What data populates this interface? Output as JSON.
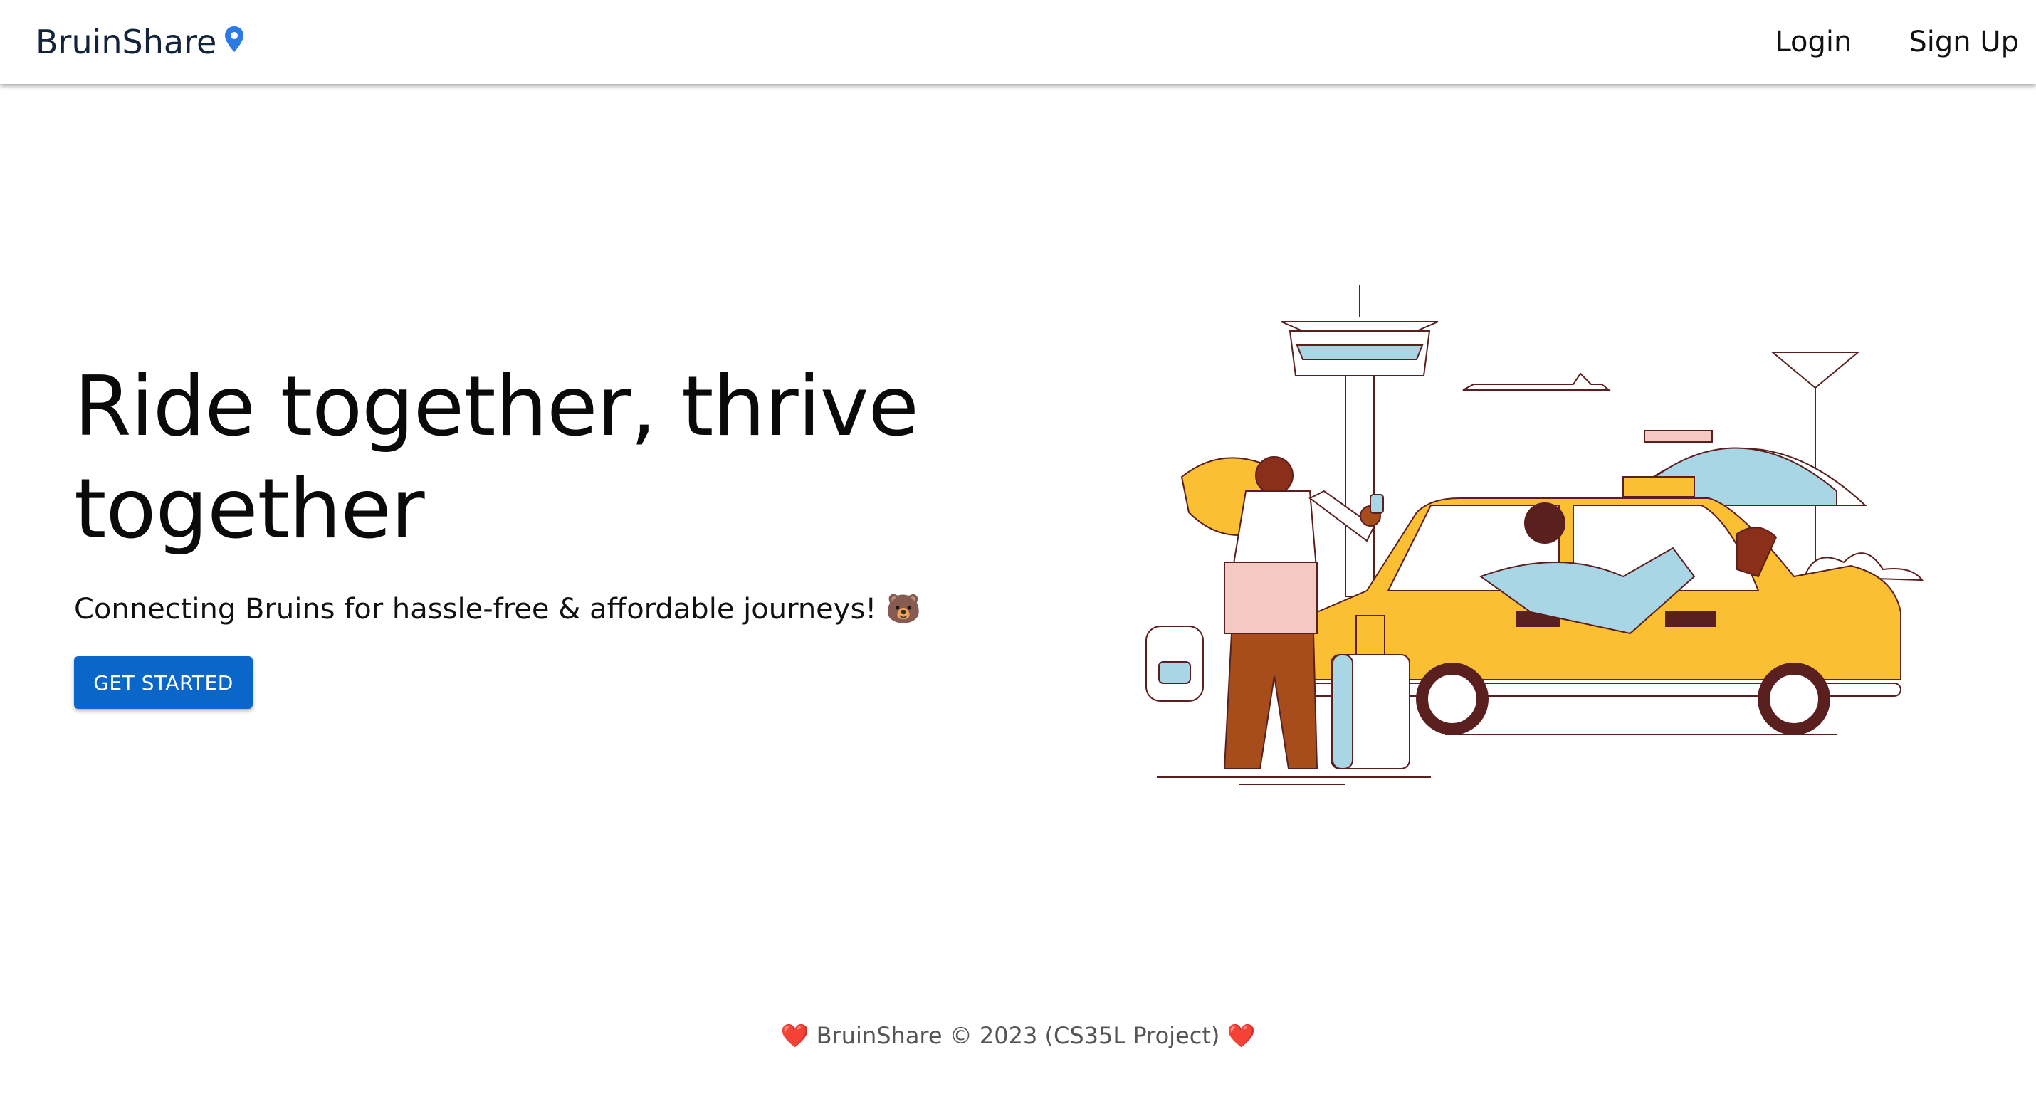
{
  "navbar": {
    "brand": "BruinShare",
    "brand_icon": "map-pin-icon",
    "login_label": "Login",
    "signup_label": "Sign Up"
  },
  "hero": {
    "title": "Ride together, thrive together",
    "subtitle": "Connecting Bruins for hassle-free & affordable journeys! 🐻",
    "cta_label": "GET STARTED",
    "illustration": "taxi-airport-illustration"
  },
  "footer": {
    "heart_left": "❤️",
    "text": "BruinShare © 2023 (CS35L Project)",
    "heart_right": "❤️"
  },
  "colors": {
    "accent": "#0a66c8",
    "brand_text": "#14233c",
    "pin": "#2b7be4",
    "taxi": "#fbbf33"
  }
}
